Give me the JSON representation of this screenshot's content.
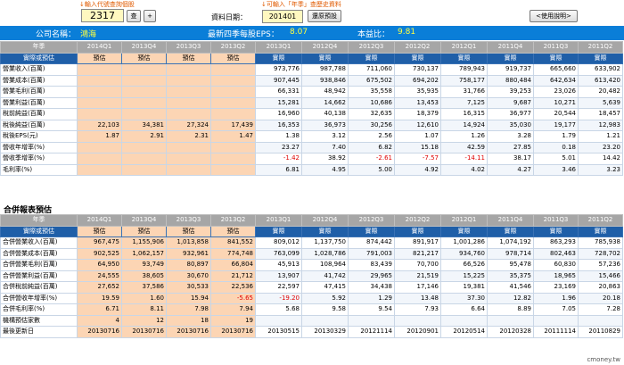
{
  "toolbar": {
    "hint_stock": "↓輸入代號查詢個股",
    "hint_date": "↓可輸入「年季」查歷史資料",
    "stock_code": "2317",
    "query_label": "查",
    "plus_label": "+",
    "date_label": "資料日期：",
    "date_value": "201401",
    "restore_label": "還原預設",
    "help_label": "<使用說明>"
  },
  "info": {
    "company_label": "公司名稱：",
    "company_name": "鴻海",
    "eps_label": "最新四季每股EPS：",
    "eps_value": "8.07",
    "pe_label": "本益比：",
    "pe_value": "9.81"
  },
  "table1": {
    "header": [
      "年季",
      "2014Q1",
      "2013Q4",
      "2013Q3",
      "2013Q2",
      "2013Q1",
      "2012Q4",
      "2012Q3",
      "2012Q2",
      "2012Q1",
      "2011Q4",
      "2011Q3",
      "2011Q2"
    ],
    "kind": [
      "實際或預估",
      "預估",
      "預估",
      "預估",
      "預估",
      "實際",
      "實際",
      "實際",
      "實際",
      "實際",
      "實際",
      "實際",
      "實際"
    ],
    "rows": [
      {
        "label": "營業收入(百萬)",
        "cells": [
          "",
          "",
          "",
          "",
          "973,776",
          "987,788",
          "711,060",
          "730,137",
          "789,943",
          "919,737",
          "665,660",
          "633,902"
        ]
      },
      {
        "label": "營業成本(百萬)",
        "cells": [
          "",
          "",
          "",
          "",
          "907,445",
          "938,846",
          "675,502",
          "694,202",
          "758,177",
          "880,484",
          "642,634",
          "613,420"
        ]
      },
      {
        "label": "營業毛利(百萬)",
        "cells": [
          "",
          "",
          "",
          "",
          "66,331",
          "48,942",
          "35,558",
          "35,935",
          "31,766",
          "39,253",
          "23,026",
          "20,482"
        ]
      },
      {
        "label": "營業利益(百萬)",
        "cells": [
          "",
          "",
          "",
          "",
          "15,281",
          "14,662",
          "10,686",
          "13,453",
          "7,125",
          "9,687",
          "10,271",
          "5,639"
        ]
      },
      {
        "label": "稅前純益(百萬)",
        "cells": [
          "",
          "",
          "",
          "",
          "16,960",
          "40,138",
          "32,635",
          "18,379",
          "16,315",
          "36,977",
          "20,544",
          "18,457"
        ]
      },
      {
        "label": "稅後純益(百萬)",
        "cells": [
          "22,103",
          "34,381",
          "27,324",
          "17,439",
          "16,353",
          "36,973",
          "30,256",
          "12,610",
          "14,924",
          "35,030",
          "19,177",
          "12,983"
        ]
      },
      {
        "label": "稅後EPS(元)",
        "cells": [
          "1.87",
          "2.91",
          "2.31",
          "1.47",
          "1.38",
          "3.12",
          "2.56",
          "1.07",
          "1.26",
          "3.28",
          "1.79",
          "1.21"
        ]
      },
      {
        "label": "營收年增率(%)",
        "cells": [
          "",
          "",
          "",
          "",
          "23.27",
          "7.40",
          "6.82",
          "15.18",
          "42.59",
          "27.85",
          "0.18",
          "23.20"
        ]
      },
      {
        "label": "營收季增率(%)",
        "cells": [
          "",
          "",
          "",
          "",
          "-1.42",
          "38.92",
          "-2.61",
          "-7.57",
          "-14.11",
          "38.17",
          "5.01",
          "14.42"
        ]
      },
      {
        "label": "毛利率(%)",
        "cells": [
          "",
          "",
          "",
          "",
          "6.81",
          "4.95",
          "5.00",
          "4.92",
          "4.02",
          "4.27",
          "3.46",
          "3.23"
        ]
      }
    ]
  },
  "section2_title": "合併報表預估",
  "table2": {
    "header": [
      "年季",
      "2014Q1",
      "2013Q4",
      "2013Q3",
      "2013Q2",
      "2013Q1",
      "2012Q4",
      "2012Q3",
      "2012Q2",
      "2012Q1",
      "2011Q4",
      "2011Q3",
      "2011Q2"
    ],
    "kind": [
      "實際或預估",
      "預估",
      "預估",
      "預估",
      "預估",
      "實際",
      "實際",
      "實際",
      "實際",
      "實際",
      "實際",
      "實際",
      "實際"
    ],
    "rows": [
      {
        "label": "合併營業收入(百萬)",
        "cells": [
          "967,475",
          "1,155,906",
          "1,013,858",
          "841,552",
          "809,012",
          "1,137,750",
          "874,442",
          "891,917",
          "1,001,286",
          "1,074,192",
          "863,293",
          "785,938"
        ]
      },
      {
        "label": "合併營業成本(百萬)",
        "cells": [
          "902,525",
          "1,062,157",
          "932,961",
          "774,748",
          "763,099",
          "1,028,786",
          "791,003",
          "821,217",
          "934,760",
          "978,714",
          "802,463",
          "728,702"
        ]
      },
      {
        "label": "合併營業毛利(百萬)",
        "cells": [
          "64,950",
          "93,749",
          "80,897",
          "66,804",
          "45,913",
          "108,964",
          "83,439",
          "70,700",
          "66,526",
          "95,478",
          "60,830",
          "57,236"
        ]
      },
      {
        "label": "合併營業利益(百萬)",
        "cells": [
          "24,555",
          "38,605",
          "30,670",
          "21,712",
          "13,907",
          "41,742",
          "29,965",
          "21,519",
          "15,225",
          "35,375",
          "18,965",
          "15,466"
        ]
      },
      {
        "label": "合併稅前純益(百萬)",
        "cells": [
          "27,652",
          "37,586",
          "30,533",
          "22,536",
          "22,597",
          "47,415",
          "34,438",
          "17,146",
          "19,381",
          "41,546",
          "23,169",
          "20,863"
        ]
      },
      {
        "label": "合併營收年增率(%)",
        "cells": [
          "19.59",
          "1.60",
          "15.94",
          "-5.65",
          "-19.20",
          "5.92",
          "1.29",
          "13.48",
          "37.30",
          "12.82",
          "1.96",
          "20.18"
        ]
      },
      {
        "label": "合併毛利率(%)",
        "cells": [
          "6.71",
          "8.11",
          "7.98",
          "7.94",
          "5.68",
          "9.58",
          "9.54",
          "7.93",
          "6.64",
          "8.89",
          "7.05",
          "7.28"
        ]
      },
      {
        "label": "機構預估家數",
        "cells": [
          "4",
          "12",
          "18",
          "19",
          "",
          "",
          "",
          "",
          "",
          "",
          "",
          ""
        ]
      },
      {
        "label": "最後更新日",
        "cells": [
          "20130716",
          "20130716",
          "20130716",
          "20130716",
          "20130515",
          "20130329",
          "20121114",
          "20120901",
          "20120514",
          "20120328",
          "20111114",
          "20110829"
        ]
      }
    ]
  },
  "footer": "cmoney.tw"
}
